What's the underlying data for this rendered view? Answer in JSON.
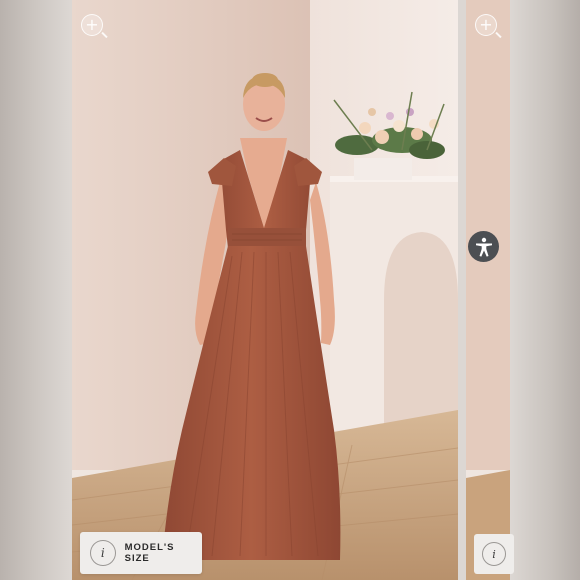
{
  "gallery": {
    "model_size_label": "MODEL'S SIZE",
    "info_glyph": "i",
    "zoom_glyph": "+",
    "icons": [
      "zoom-in-icon",
      "info-icon",
      "accessibility-icon"
    ]
  },
  "colors": {
    "wall": "#e8d3c8",
    "dress": "#a8593f",
    "floor": "#c9a37d",
    "accessibility_button": "#4c4f53",
    "model_size_card": "#efedeb"
  }
}
